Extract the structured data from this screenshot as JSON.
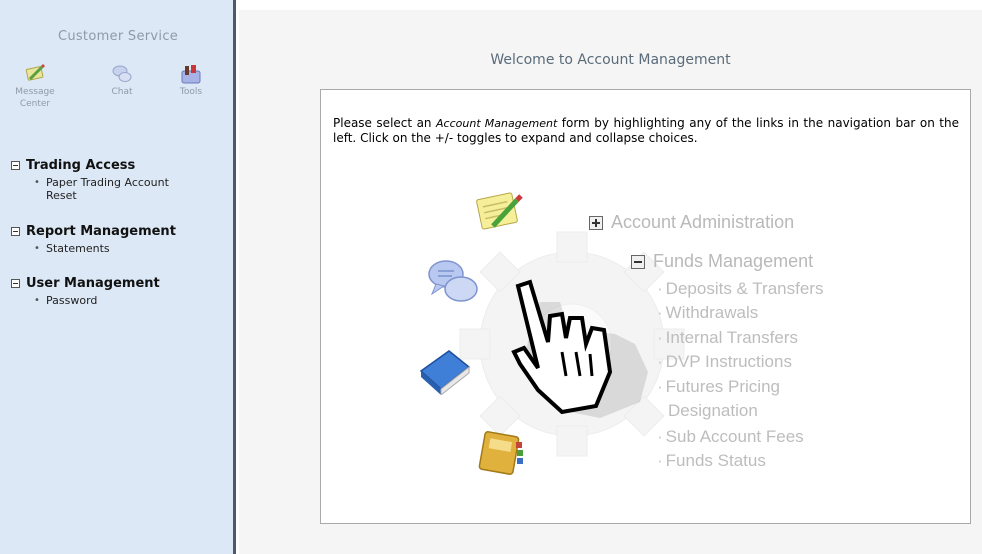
{
  "sidebar": {
    "title": "Customer Service",
    "icons": [
      {
        "label1": "Message",
        "label2": "Center",
        "icon": "message-center-icon"
      },
      {
        "label1": "Chat",
        "label2": "",
        "icon": "chat-icon"
      },
      {
        "label1": "Tools",
        "label2": "",
        "icon": "tools-icon"
      }
    ],
    "sections": [
      {
        "title": "Trading Access",
        "items": [
          {
            "line1": "Paper Trading Account",
            "line2": "Reset"
          }
        ]
      },
      {
        "title": "Report Management",
        "items": [
          {
            "line1": "Statements",
            "line2": ""
          }
        ]
      },
      {
        "title": "User Management",
        "items": [
          {
            "line1": "Password",
            "line2": ""
          }
        ]
      }
    ]
  },
  "main": {
    "welcome": "Welcome to Account Management",
    "intro_before": "Please select an ",
    "intro_emph": "Account Management",
    "intro_after": " form by highlighting any of the links in the navigation bar on the left. Click on the +/- toggles to expand and collapse choices.",
    "illustration": {
      "tree": {
        "account_admin": "Account Administration",
        "funds_mgmt": "Funds Management",
        "bullet": "·",
        "items": [
          "Deposits & Transfers",
          "Withdrawals",
          "Internal Transfers",
          "DVP Instructions",
          "Futures Pricing",
          "Designation",
          "Sub Account Fees",
          "Funds Status"
        ]
      }
    }
  },
  "colors": {
    "sidebar_bg": "#dde8f6",
    "sidebar_border": "#4f5a69",
    "main_bg": "#f5f5f5",
    "muted_text": "#8e9aa8"
  }
}
